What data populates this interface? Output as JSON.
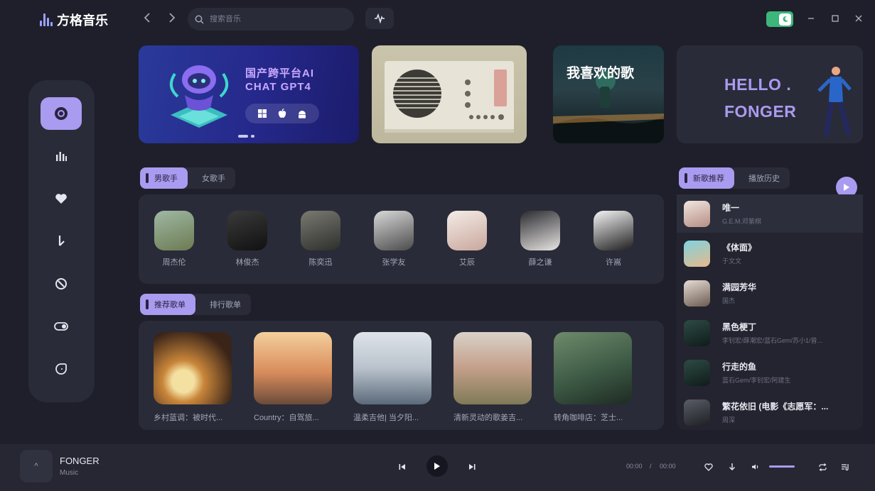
{
  "app": {
    "name": "方格音乐"
  },
  "search": {
    "placeholder": "搜索音乐"
  },
  "banners": {
    "ai_title": "国产跨平台AI",
    "ai_subtitle": "CHAT GPT4",
    "favorite_title": "我喜欢的歌",
    "hello_line1": "HELLO .",
    "hello_line2": "FONGER"
  },
  "singer_tabs": [
    "男歌手",
    "女歌手"
  ],
  "singers": [
    "周杰伦",
    "林俊杰",
    "陈奕迅",
    "张学友",
    "艾辰",
    "薛之谦",
    "许嵩"
  ],
  "playlist_tabs": [
    "推荐歌单",
    "排行歌单"
  ],
  "playlists": [
    "乡村蓝调：被时代...",
    "Country：自驾旅...",
    "温柔吉他| 当夕阳...",
    "清新灵动的歌姜吉...",
    "转角咖啡店：芝士..."
  ],
  "song_tabs": [
    "新歌推荐",
    "播放历史"
  ],
  "songs": [
    {
      "title": "唯一",
      "artist": "G.E.M.邓紫棋"
    },
    {
      "title": "《体面》",
      "artist": "于文文"
    },
    {
      "title": "满园芳华",
      "artist": "国杰"
    },
    {
      "title": "黑色梗丁",
      "artist": "李钊宏/薛潮宏/蓝石Gem/苏小1/曾..."
    },
    {
      "title": "行走的鱼",
      "artist": "蓝石Gem/李钊宏/阿建生"
    },
    {
      "title": "繁花依旧 (电影《志愿军：...",
      "artist": "周深"
    }
  ],
  "player": {
    "title": "FONGER",
    "subtitle": "Music",
    "cover_glyph": "^",
    "time_current": "00:00",
    "time_separator": "/",
    "time_total": "00:00"
  },
  "colors": {
    "accent": "#a99bf0",
    "background": "#1e1f2a",
    "panel": "#2a2b38",
    "toggle": "#3cb67b"
  }
}
